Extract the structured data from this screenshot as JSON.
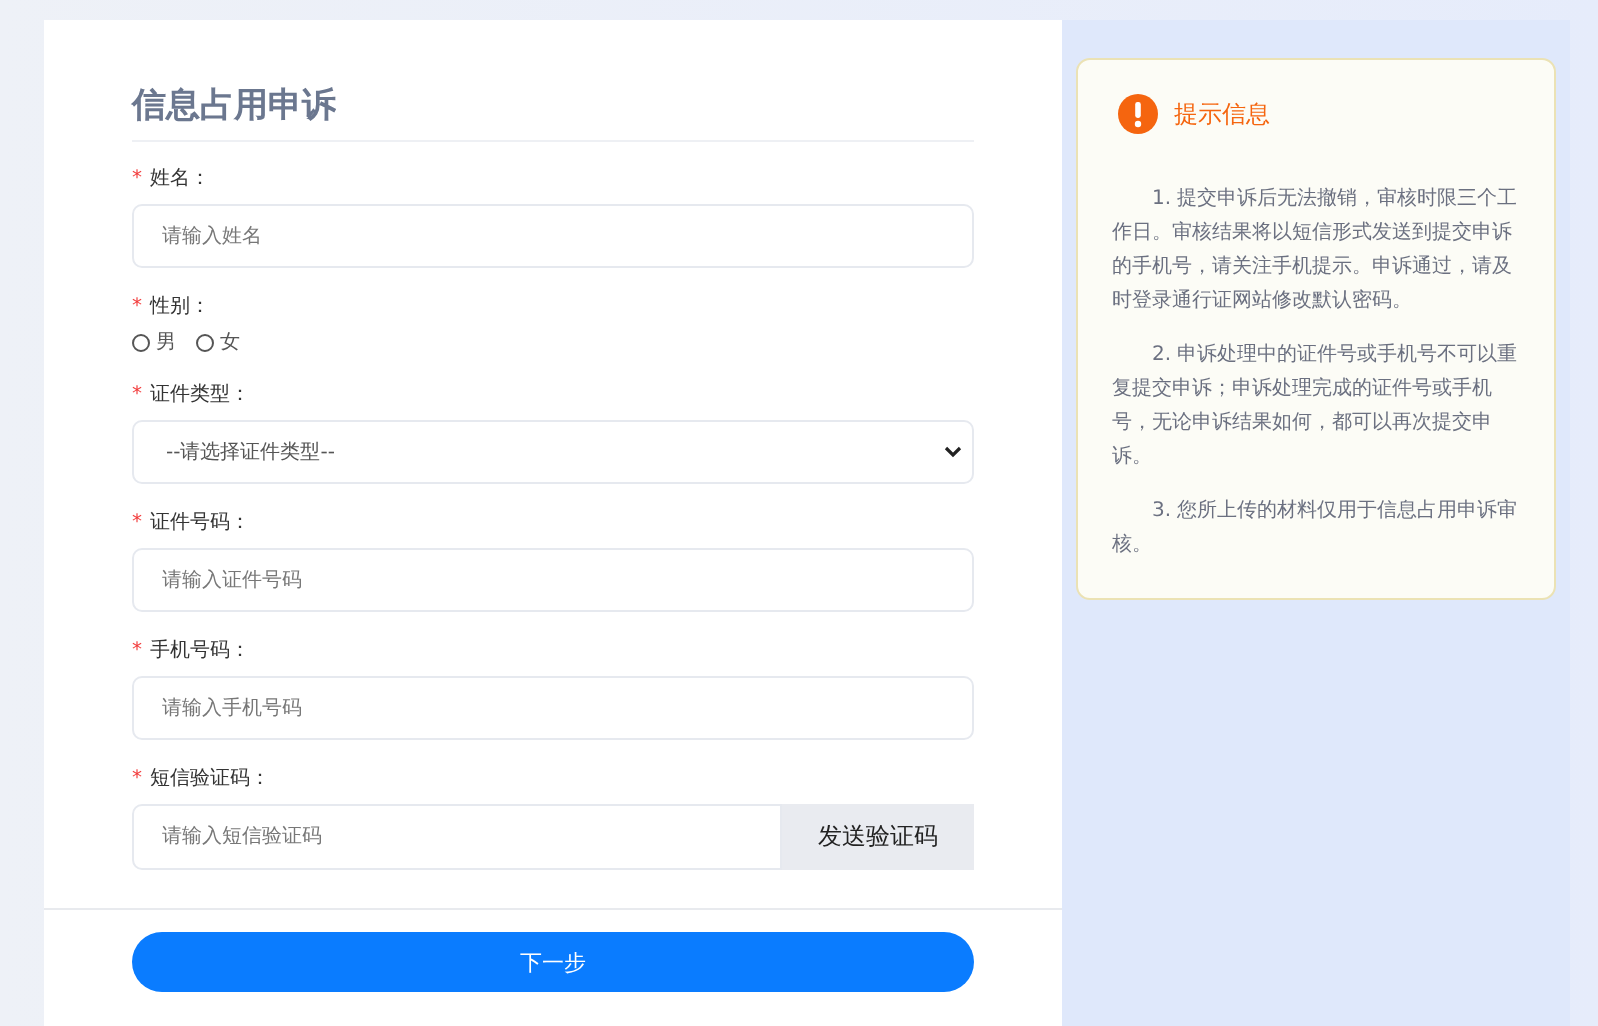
{
  "title": "信息占用申诉",
  "fields": [
    {
      "kind": "text",
      "mark": "*",
      "label": "姓名：",
      "placeholder": "请输入姓名"
    },
    {
      "kind": "radio",
      "mark": "*",
      "label": "性别：",
      "options": [
        {
          "label": "男",
          "selected": false
        },
        {
          "label": "女",
          "selected": false
        }
      ]
    },
    {
      "kind": "select",
      "mark": "*",
      "label": "证件类型：",
      "value": "--请选择证件类型--"
    },
    {
      "kind": "text",
      "mark": "*",
      "label": "证件号码：",
      "placeholder": "请输入证件号码"
    },
    {
      "kind": "text",
      "mark": "*",
      "label": "手机号码：",
      "placeholder": "请输入手机号码"
    },
    {
      "kind": "code",
      "mark": "*",
      "label": "短信验证码：",
      "placeholder": "请输入短信验证码",
      "button": "发送验证码"
    }
  ],
  "submit": "下一步",
  "notice": {
    "title": "提示信息",
    "paragraphs": [
      "1. 提交申诉后无法撤销，审核时限三个工作日。审核结果将以短信形式发送到提交申诉的手机号，请关注手机提示。申诉通过，请及时登录通行证网站修改默认密码。",
      "2. 申诉处理中的证件号或手机号不可以重复提交申诉；申诉处理完成的证件号或手机号，无论申诉结果如何，都可以再次提交申诉。",
      "3. 您所上传的材料仅用于信息占用申诉审核。"
    ]
  }
}
